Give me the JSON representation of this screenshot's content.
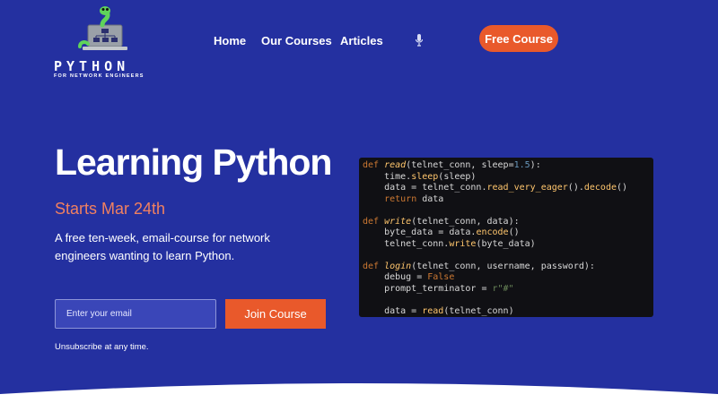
{
  "logo": {
    "title": "PYTHON",
    "subtitle": "FOR NETWORK ENGINEERS"
  },
  "nav": {
    "items": [
      {
        "label": "Home"
      },
      {
        "label": "Our Courses"
      },
      {
        "label": "Articles"
      }
    ],
    "cta_label": "Free Course"
  },
  "hero": {
    "title": "Learning Python",
    "date": "Starts Mar 24th",
    "description": "A free ten-week, email-course for network engineers wanting to learn Python."
  },
  "signup": {
    "email_placeholder": "Enter your email",
    "button_label": "Join Course",
    "note": "Unsubscribe at any time."
  },
  "code_lines": [
    "def read(telnet_conn, sleep=1.5):",
    "    time.sleep(sleep)",
    "    data = telnet_conn.read_very_eager().decode()",
    "    return data",
    "",
    "def write(telnet_conn, data):",
    "    byte_data = data.encode()",
    "    telnet_conn.write(byte_data)",
    "",
    "def login(telnet_conn, username, password):",
    "    debug = False",
    "    prompt_terminator = r\"#\"",
    "",
    "    data = read(telnet_conn)"
  ],
  "colors": {
    "background": "#2430a0",
    "accent": "#e9592b",
    "date": "#f08060"
  },
  "icons": {
    "logo": "snake-laptop-icon",
    "mic": "microphone-icon"
  }
}
